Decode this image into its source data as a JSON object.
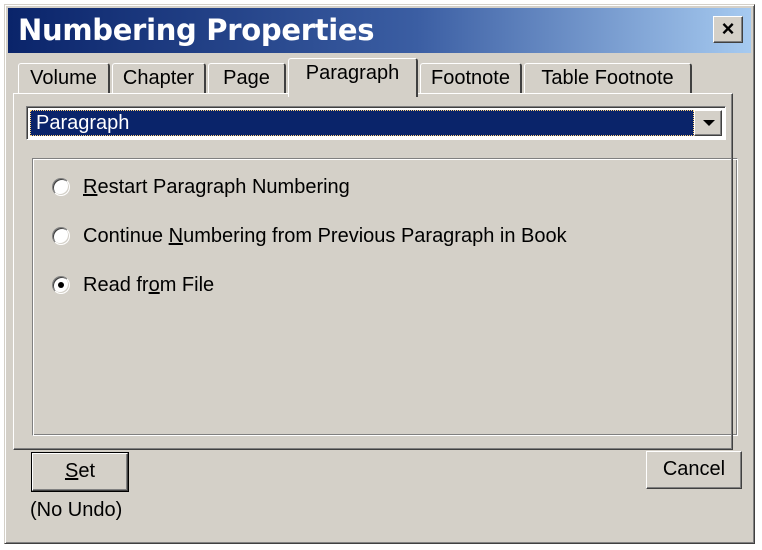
{
  "window": {
    "title": "Numbering Properties",
    "close_label": "×"
  },
  "tabs": [
    {
      "label": "Volume",
      "active": false
    },
    {
      "label": "Chapter",
      "active": false
    },
    {
      "label": "Page",
      "active": false
    },
    {
      "label": "Paragraph",
      "active": true
    },
    {
      "label": "Footnote",
      "active": false
    },
    {
      "label": "Table Footnote",
      "active": false
    }
  ],
  "dropdown": {
    "selected": "Paragraph"
  },
  "options": [
    {
      "pre": "",
      "accel": "R",
      "post": "estart Paragraph Numbering",
      "checked": false
    },
    {
      "pre": "Continue ",
      "accel": "N",
      "post": "umbering from Previous Paragraph in Book",
      "checked": false
    },
    {
      "pre": "Read fr",
      "accel": "o",
      "post": "m File",
      "checked": true
    }
  ],
  "buttons": {
    "set_accel": "S",
    "set_rest": "et",
    "cancel": "Cancel"
  },
  "note": "(No Undo)",
  "colors": {
    "title_start": "#0a246a",
    "title_end": "#a6caf0",
    "face": "#d4d0c8",
    "selection": "#0a246a"
  }
}
